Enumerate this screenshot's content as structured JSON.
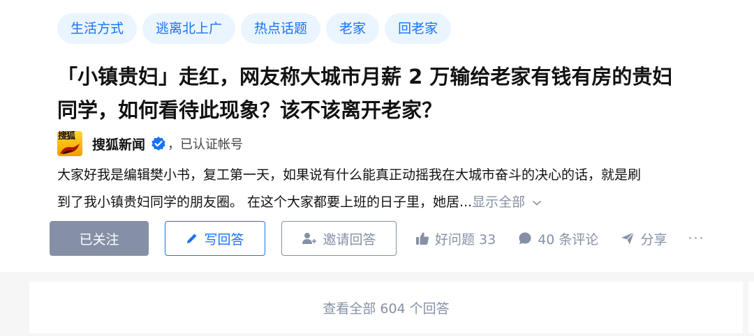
{
  "tags": [
    "生活方式",
    "逃离北上广",
    "热点话题",
    "老家",
    "回老家"
  ],
  "question": {
    "title_line1": "「小镇贵妇」走红，网友称大城市月薪 2 万输给老家有钱有房的贵妇",
    "title_line2": "同学，如何看待此现象？该不该离开老家？"
  },
  "author": {
    "avatar_text": "搜狐",
    "name": "搜狐新闻",
    "verified_label": "，已认证帐号"
  },
  "content": {
    "line1": "大家好我是编辑樊小书，复工第一天，如果说有什么能真正动摇我在大城市奋斗的决心的话，就是刷",
    "line2": "到了我小镇贵妇同学的朋友圈。 在这个大家都要上班的日子里，她居...",
    "show_all": "显示全部"
  },
  "actions": {
    "follow": "已关注",
    "write": "写回答",
    "invite": "邀请回答",
    "good_question": "好问题 33",
    "comments": "40 条评论",
    "share": "分享",
    "more": "···"
  },
  "footer": {
    "view_all": "查看全部 604 个回答"
  },
  "colors": {
    "accent": "#1772f6",
    "tag_bg": "#ebf5ff",
    "muted": "#8590a6",
    "page_bg": "#f6f6f6"
  }
}
